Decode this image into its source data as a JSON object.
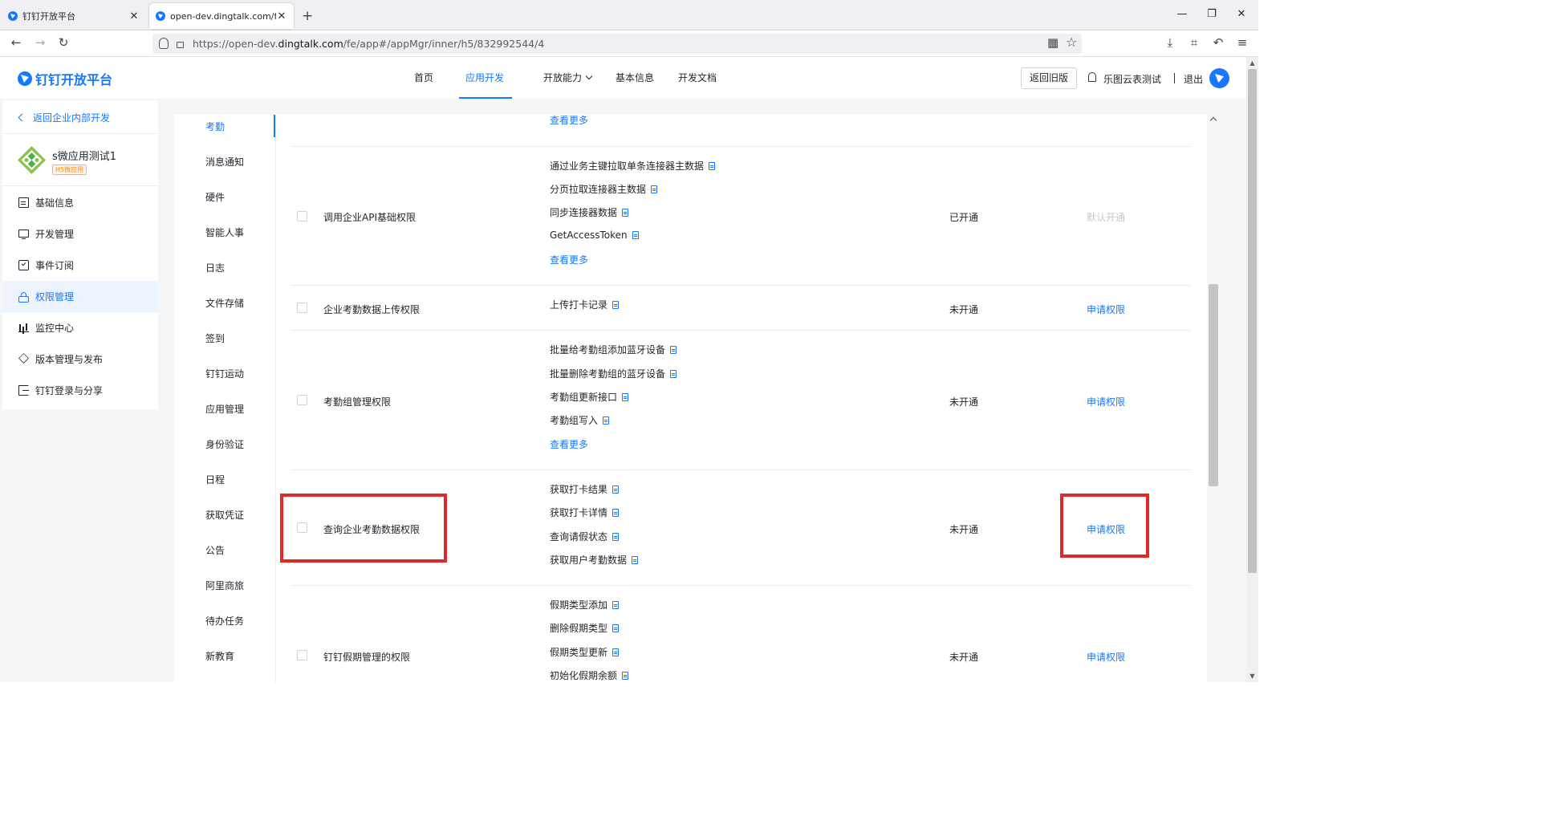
{
  "browser": {
    "tabs": [
      {
        "title": "钉钉开放平台",
        "close": "✕"
      },
      {
        "title": "open-dev.dingtalk.com/fe/ap",
        "close": "✕"
      }
    ],
    "new_tab": "+",
    "url_prefix": "https://open-dev.",
    "url_domain": "dingtalk.com",
    "url_path": "/fe/app#/appMgr/inner/h5/832992544/4",
    "icons": {
      "back": "←",
      "forward": "→",
      "reload": "↻",
      "qr": "▦",
      "star": "☆",
      "download": "⤓",
      "crop": "⌗",
      "undo": "↶",
      "menu": "≡",
      "minimize": "—",
      "restore": "❐",
      "close": "✕"
    }
  },
  "header": {
    "brand": "钉钉开放平台",
    "nav": [
      "首页",
      "应用开发",
      "开放能力",
      "基本信息",
      "开发文档"
    ],
    "old_version": "返回旧版",
    "org_name": "乐图云表测试",
    "logout": "退出"
  },
  "sidebar": {
    "back": "返回企业内部开发",
    "app_name": "s微应用测试1",
    "app_tag": "H5微应用",
    "items": [
      "基础信息",
      "开发管理",
      "事件订阅",
      "权限管理",
      "监控中心",
      "版本管理与发布",
      "钉钉登录与分享"
    ]
  },
  "categories": [
    "考勤",
    "消息通知",
    "硬件",
    "智能人事",
    "日志",
    "文件存储",
    "签到",
    "钉钉运动",
    "应用管理",
    "身份验证",
    "日程",
    "获取凭证",
    "公告",
    "阿里商旅",
    "待办任务",
    "新教育"
  ],
  "table": {
    "top_more": "查看更多",
    "rows": [
      {
        "name": "调用企业API基础权限",
        "apis": [
          "通过业务主键拉取单条连接器主数据",
          "分页拉取连接器主数据",
          "同步连接器数据",
          "GetAccessToken"
        ],
        "more": "查看更多",
        "status": "已开通",
        "action": "默认开通"
      },
      {
        "name": "企业考勤数据上传权限",
        "apis": [
          "上传打卡记录"
        ],
        "status": "未开通",
        "action": "申请权限"
      },
      {
        "name": "考勤组管理权限",
        "apis": [
          "批量给考勤组添加蓝牙设备",
          "批量删除考勤组的蓝牙设备",
          "考勤组更新接口",
          "考勤组写入"
        ],
        "more": "查看更多",
        "status": "未开通",
        "action": "申请权限"
      },
      {
        "name": "查询企业考勤数据权限",
        "apis": [
          "获取打卡结果",
          "获取打卡详情",
          "查询请假状态",
          "获取用户考勤数据"
        ],
        "status": "未开通",
        "action": "申请权限"
      },
      {
        "name": "钉钉假期管理的权限",
        "apis": [
          "假期类型添加",
          "删除假期类型",
          "假期类型更新",
          "初始化假期余额"
        ],
        "status": "未开通",
        "action": "申请权限"
      }
    ]
  },
  "colors": {
    "accent": "#1677ff",
    "highlight": "#e02a2a"
  }
}
